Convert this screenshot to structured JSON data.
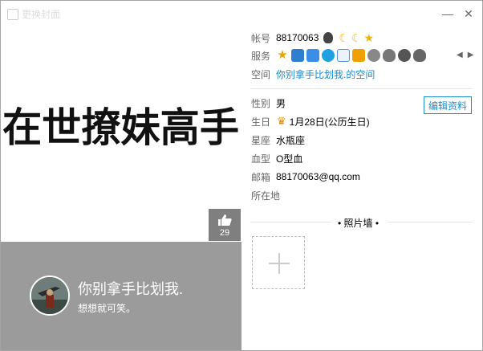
{
  "window": {
    "title": "更换封面",
    "minimize_label": "—",
    "close_label": "✕"
  },
  "cover": {
    "calligraphy_text": "在世撩妹高手",
    "likes": "29",
    "nickname": "你别拿手比划我.",
    "signature": "想想就可笑。"
  },
  "account": {
    "label": "帐号",
    "value": "88170063",
    "badges": [
      "qq-level-icon",
      "moon-icon",
      "moon-icon",
      "star-icon"
    ]
  },
  "services": {
    "label": "服务",
    "icons": [
      "star-service-icon",
      "camera-service-icon",
      "shield-service-icon",
      "refresh-service-icon",
      "mail-service-icon",
      "wallet-service-icon",
      "heart-service-icon",
      "penguin-service-icon",
      "diamond-service-icon",
      "penguin-gray-service-icon"
    ],
    "prev": "◀",
    "next": "▶"
  },
  "space": {
    "label": "空间",
    "value": "你别拿手比划我.的空间"
  },
  "details": {
    "gender_label": "性别",
    "gender": "男",
    "birthday_label": "生日",
    "birthday": "1月28日(公历生日)",
    "zodiac_label": "星座",
    "zodiac": "水瓶座",
    "blood_label": "血型",
    "blood": "O型血",
    "email_label": "邮箱",
    "email": "88170063@qq.com",
    "location_label": "所在地"
  },
  "edit_button": "编辑资料",
  "photo_wall": {
    "title": "• 照片墙 •"
  },
  "colors": {
    "accent": "#1a8ccd",
    "band": "#9b9b9b",
    "like_box": "#7f7f7f"
  }
}
